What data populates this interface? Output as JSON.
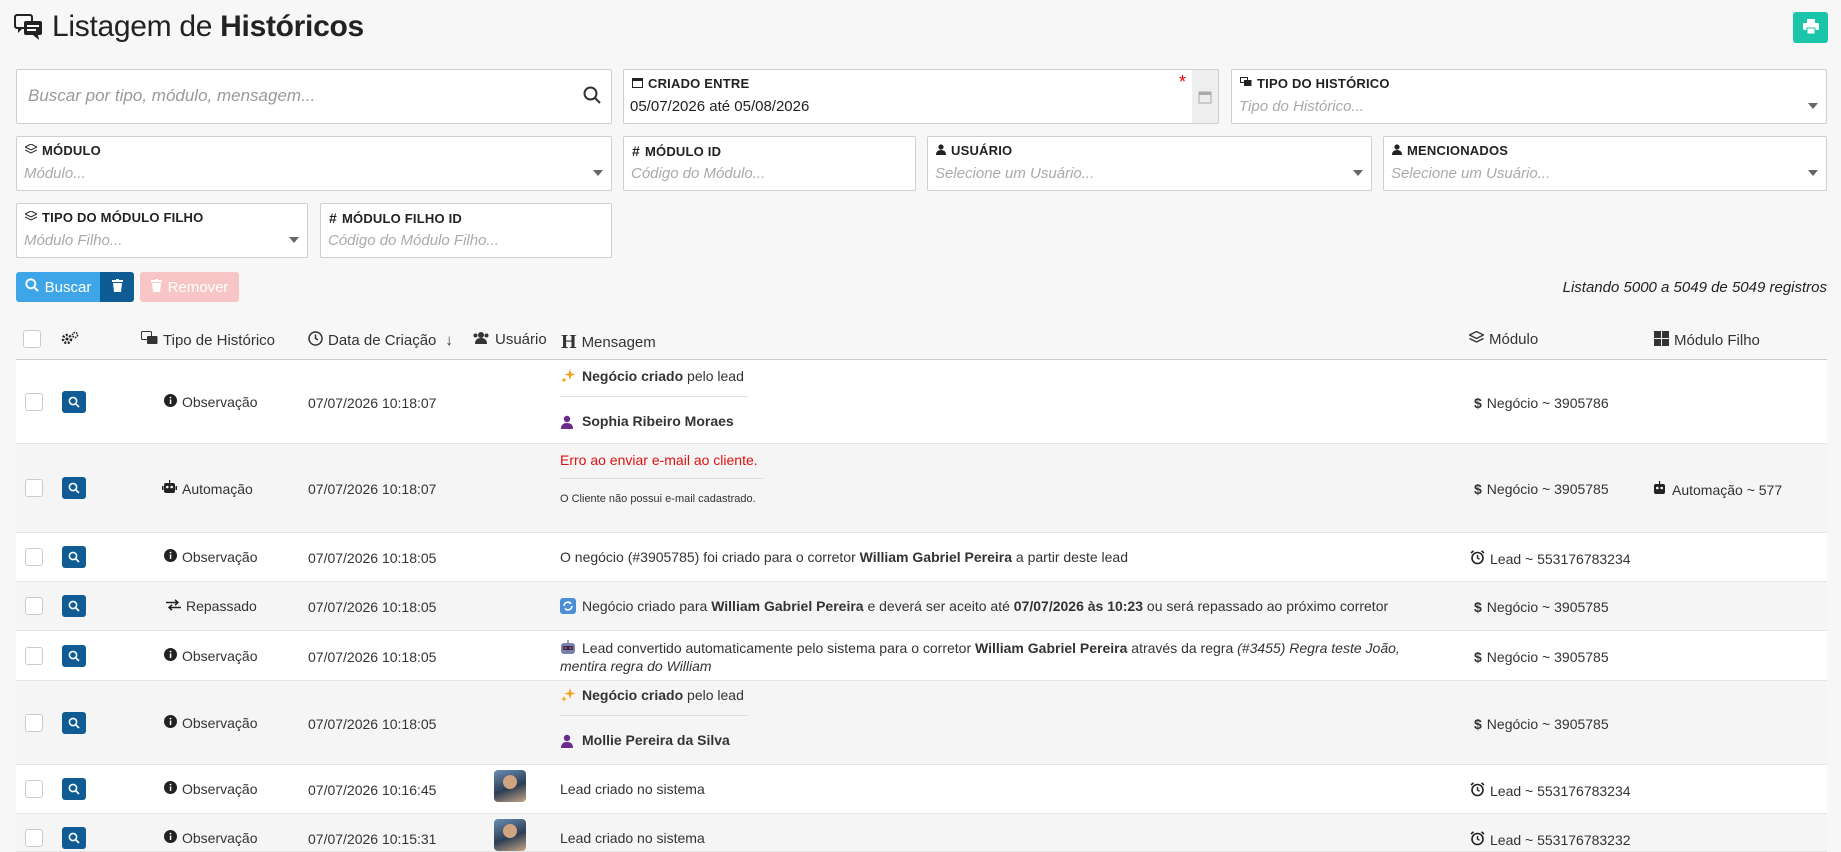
{
  "header": {
    "title_prefix": "Listagem de ",
    "title_bold": "Históricos"
  },
  "filters": {
    "search_placeholder": "Buscar por tipo, módulo, mensagem...",
    "criado_entre": {
      "label": "Criado entre",
      "value": "05/07/2026 até 05/08/2026",
      "required_mark": "*"
    },
    "tipo_historico": {
      "label": "Tipo do Histórico",
      "placeholder": "Tipo do Histórico..."
    },
    "modulo": {
      "label": "Módulo",
      "placeholder": "Módulo..."
    },
    "modulo_id": {
      "label": "Módulo ID",
      "placeholder": "Código do Módulo..."
    },
    "usuario": {
      "label": "Usuário",
      "placeholder": "Selecione um Usuário..."
    },
    "mencionados": {
      "label": "Mencionados",
      "placeholder": "Selecione um Usuário..."
    },
    "tipo_modulo_filho": {
      "label": "Tipo do Módulo Filho",
      "placeholder": "Módulo Filho..."
    },
    "modulo_filho_id": {
      "label": "Módulo Filho ID",
      "placeholder": "Código do Módulo Filho..."
    }
  },
  "actions": {
    "buscar": "Buscar",
    "remover": "Remover"
  },
  "listing_text": "Listando 5000 a 5049 de 5049 registros",
  "table": {
    "columns": {
      "tipo": "Tipo de Histórico",
      "data": "Data de Criação",
      "usuario": "Usuário",
      "mensagem": "Mensagem",
      "modulo": "Módulo",
      "modulo_filho": "Módulo Filho"
    },
    "rows": [
      {
        "tipo": "Observação",
        "data": "07/07/2026 10:18:07",
        "msg_a_bold": "Negócio criado",
        "msg_a_rest": " pelo lead",
        "msg_b": "Sophia Ribeiro Moraes",
        "modulo": "Negócio ~ 3905786"
      },
      {
        "tipo": "Automação",
        "data": "07/07/2026 10:18:07",
        "msg_a": "Erro ao enviar e-mail ao cliente.",
        "msg_b": "O Cliente não possui e-mail cadastrado.",
        "modulo": "Negócio ~ 3905785",
        "filho": "Automação ~ 577"
      },
      {
        "tipo": "Observação",
        "data": "07/07/2026 10:18:05",
        "msg_1": "O negócio (#3905785) foi criado para o corretor ",
        "msg_2": "William Gabriel Pereira",
        "msg_3": " a partir deste lead",
        "modulo": "Lead ~ 553176783234"
      },
      {
        "tipo": "Repassado",
        "data": "07/07/2026 10:18:05",
        "msg_1": "Negócio criado para ",
        "msg_2": "William Gabriel Pereira",
        "msg_3": " e deverá ser aceito até ",
        "msg_4": "07/07/2026 às 10:23",
        "msg_5": " ou será repassado ao próximo corretor",
        "modulo": "Negócio ~ 3905785"
      },
      {
        "tipo": "Observação",
        "data": "07/07/2026 10:18:05",
        "msg_1": "Lead convertido automaticamente pelo sistema para o corretor ",
        "msg_2": "William Gabriel Pereira",
        "msg_3": " através da regra ",
        "msg_4": "(#3455) Regra teste João,",
        "msg_5": "mentira regra do William",
        "modulo": "Negócio ~ 3905785"
      },
      {
        "tipo": "Observação",
        "data": "07/07/2026 10:18:05",
        "msg_a_bold": "Negócio criado",
        "msg_a_rest": " pelo lead",
        "msg_b": "Mollie Pereira da Silva",
        "modulo": "Negócio ~ 3905785"
      },
      {
        "tipo": "Observação",
        "data": "07/07/2026 10:16:45",
        "msg": "Lead criado no sistema",
        "modulo": "Lead ~ 553176783234"
      },
      {
        "tipo": "Observação",
        "data": "07/07/2026 10:15:31",
        "msg": "Lead criado no sistema",
        "modulo": "Lead ~ 553176783232"
      }
    ]
  },
  "colors": {
    "primary": "#0f5c95",
    "buscar": "#3ea6e8",
    "print": "#1bc5a9",
    "error": "#e01010",
    "remover_disabled": "#f7c5c5"
  }
}
